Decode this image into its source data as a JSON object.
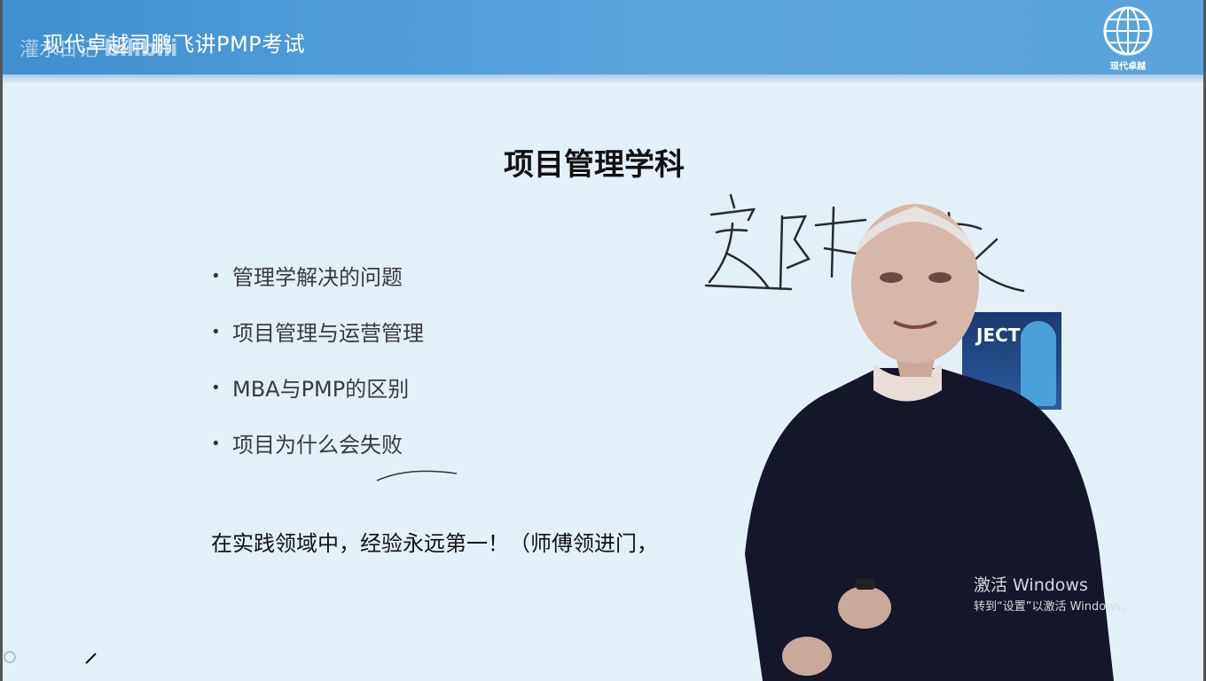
{
  "header": {
    "title": "现代卓越司鹏飞讲PMP考试",
    "watermark_prefix": "灌水日记",
    "watermark_brand": "bilibili",
    "logo_caption": "现代卓越"
  },
  "slide": {
    "heading": "项目管理学科",
    "bullets": [
      "管理学解决的问题",
      "项目管理与运营管理",
      "MBA与PMP的区别",
      "项目为什么会失败"
    ],
    "note": "在实践领域中，经验永远第一！（师傅领进门，",
    "book_text": "JECT"
  },
  "handwriting": {
    "text": "实践"
  },
  "os_overlay": {
    "activation_title": "激活 Windows",
    "activation_subtitle": "转到“设置”以激活 Windows。"
  },
  "colors": {
    "header_bar": "#4a97d4",
    "slide_bg": "#e4f0f8",
    "presenter_jacket": "#14162a"
  }
}
